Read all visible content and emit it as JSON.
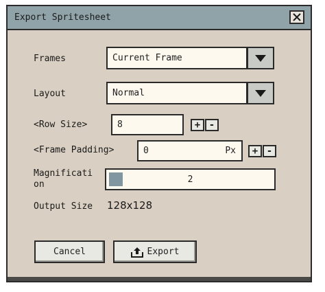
{
  "dialog": {
    "title": "Export Spritesheet",
    "close_icon": "close-icon"
  },
  "form": {
    "frames_label": "Frames",
    "frames_value": "Current Frame",
    "layout_label": "Layout",
    "layout_value": "Normal",
    "row_size_label": "<Row Size>",
    "row_size_value": "8",
    "frame_padding_label": "<Frame Padding>",
    "frame_padding_value": "0",
    "frame_padding_unit": "Px",
    "magnification_label_line1": "Magnificati",
    "magnification_label_line2": "on",
    "magnification_value": "2",
    "output_size_label": "Output Size",
    "output_size_value": "128x128",
    "plus": "+",
    "minus": "-"
  },
  "buttons": {
    "cancel": "Cancel",
    "export": "Export",
    "export_icon": "export-icon"
  }
}
